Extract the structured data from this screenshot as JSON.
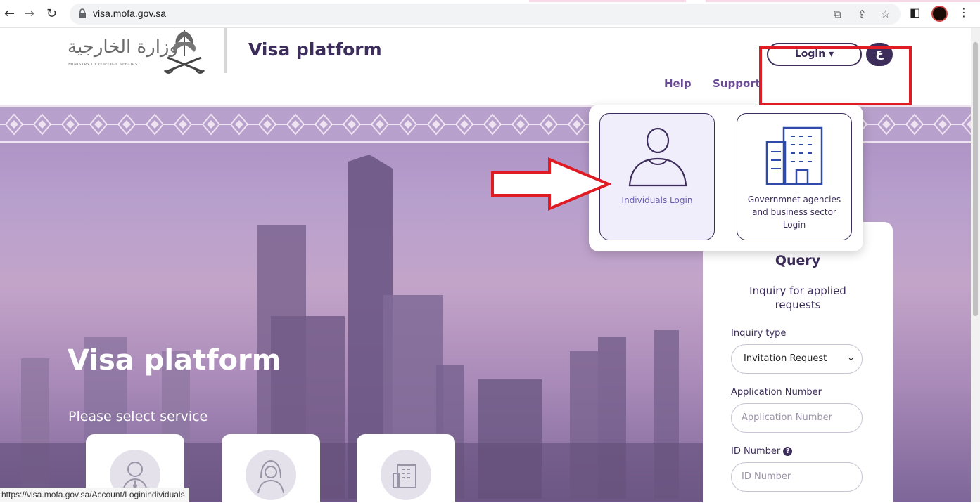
{
  "browser": {
    "url": "visa.mofa.gov.sa",
    "status_url": "https://visa.mofa.gov.sa/Account/Loginindividuals"
  },
  "header": {
    "logo_arabic": "وزارة الخارجية",
    "logo_english": "MINISTRY OF FOREIGN AFFAIRS",
    "title": "Visa platform",
    "nav": {
      "help": "Help",
      "support": "Support",
      "login": "Login ▾",
      "lang": "ع"
    }
  },
  "hero": {
    "title": "Visa platform",
    "subtitle": "Please select service"
  },
  "login_menu": {
    "individuals": "Individuals Login",
    "government": [
      "Governmnet agencies",
      "and business sector",
      "Login"
    ]
  },
  "query": {
    "title": "Query",
    "subtitle": "Inquiry for applied requests",
    "inquiry_type_label": "Inquiry type",
    "inquiry_type_value": "Invitation Request",
    "application_label": "Application Number",
    "application_placeholder": "Application Number",
    "id_label": "ID Number",
    "id_placeholder": "ID Number"
  },
  "colors": {
    "brand": "#3c2d5a",
    "link": "#6a4b93",
    "highlight": "#e01b24"
  }
}
